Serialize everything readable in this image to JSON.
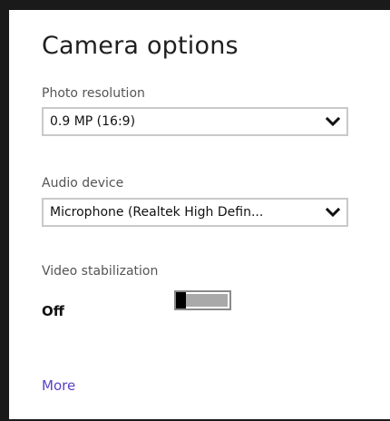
{
  "panel": {
    "title": "Camera options"
  },
  "photo_resolution": {
    "label": "Photo resolution",
    "value": "0.9 MP (16:9)"
  },
  "audio_device": {
    "label": "Audio device",
    "value": "Microphone (Realtek High Defin..."
  },
  "video_stabilization": {
    "label": "Video stabilization",
    "state_text": "Off",
    "enabled": false
  },
  "footer": {
    "more_label": "More"
  },
  "colors": {
    "link": "#5b3fc4",
    "toggle_track": "#a9a9a9",
    "toggle_thumb": "#000000",
    "dropdown_border": "#c9c9c9"
  },
  "icons": {
    "dropdown": "chevron-down-icon"
  }
}
